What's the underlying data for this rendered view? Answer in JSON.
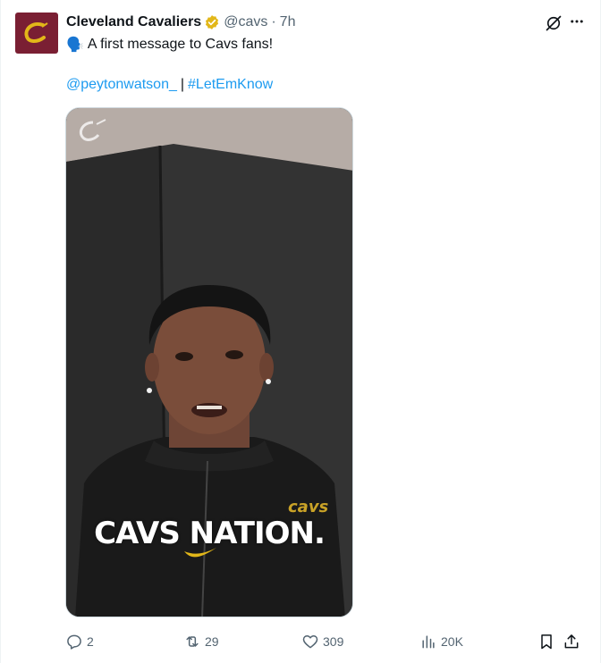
{
  "tweet": {
    "author": {
      "display_name": "Cleveland Cavaliers",
      "handle": "@cavs",
      "time": "7h",
      "avatar_icon": "cavs-c-logo-icon",
      "verified_color": "#e2b719",
      "avatar_color": "#7a1f33"
    },
    "text": {
      "emoji": "🗣️",
      "line1": "A first message to Cavs fans!",
      "mention": "@peytonwatson_",
      "separator": "|",
      "hashtag": "#LetEmKnow"
    },
    "media": {
      "overlay_text": "CAVS NATION."
    },
    "metrics": {
      "replies": "2",
      "reposts": "29",
      "likes": "309",
      "views": "20K"
    },
    "colors": {
      "link": "#1d9bf0",
      "muted": "#536471"
    }
  }
}
